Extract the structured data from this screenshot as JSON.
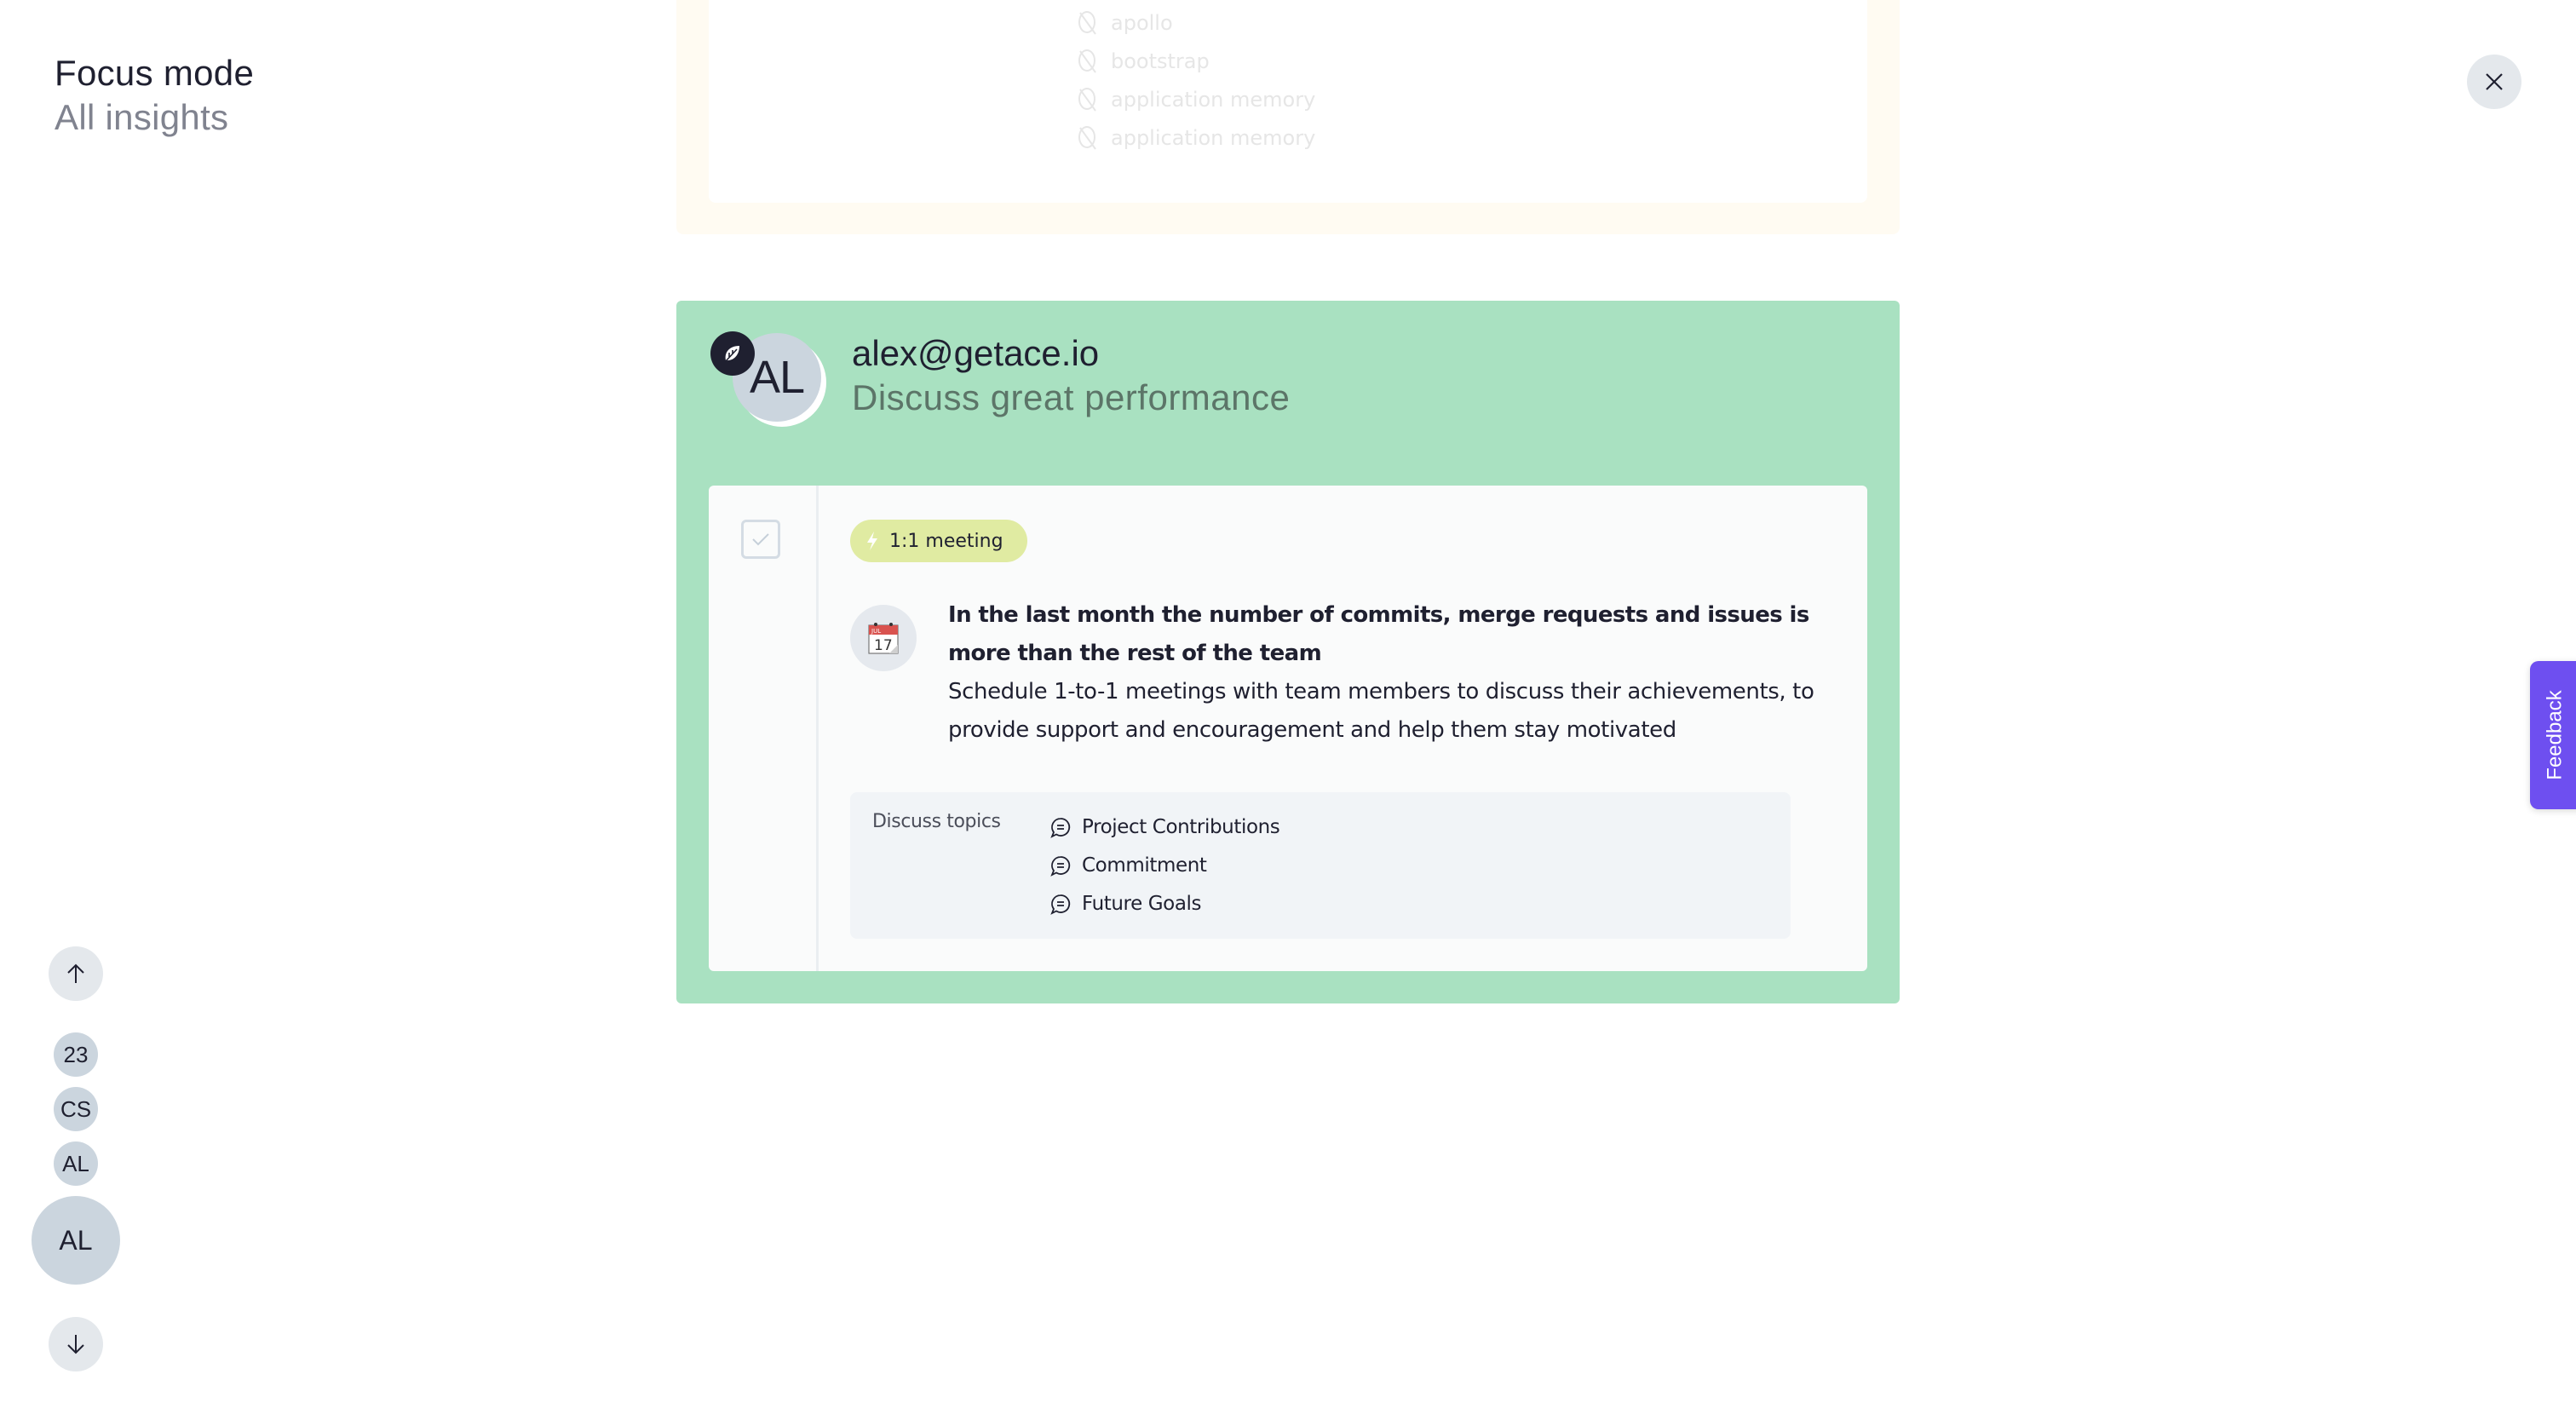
{
  "header": {
    "title": "Focus mode",
    "subtitle": "All insights"
  },
  "close_button": {
    "icon": "close-icon"
  },
  "previous_card": {
    "items": [
      {
        "icon": "leaf-off-icon",
        "label": "apollo"
      },
      {
        "icon": "leaf-off-icon",
        "label": "bootstrap"
      },
      {
        "icon": "leaf-off-icon",
        "label": "application memory"
      },
      {
        "icon": "leaf-off-icon",
        "label": "application memory"
      }
    ],
    "colors": {
      "outer": "#fffbf2"
    }
  },
  "card": {
    "avatar_initials": "AL",
    "badge_icon": "leaf-icon",
    "email": "alex@getace.io",
    "subtitle": "Discuss great performance",
    "colors": {
      "background": "#a9e1c1",
      "panel": "#fafbfb"
    },
    "checkbox": {
      "checked": false
    },
    "tag": {
      "icon": "lightning-icon",
      "label": "1:1 meeting",
      "color": "#e0eba2"
    },
    "insight": {
      "icon": "calendar-icon",
      "calendar_month": "JUL",
      "calendar_day": "17",
      "title": "In the last month the number of commits, merge requests and issues is more than the rest of the team",
      "description": "Schedule 1-to-1 meetings with team members to discuss their achievements, to provide support and encouragement and help them stay motivated"
    },
    "topics": {
      "label": "Discuss topics",
      "items": [
        {
          "icon": "chat-bubble-icon",
          "label": "Project Contributions"
        },
        {
          "icon": "chat-bubble-icon",
          "label": "Commitment"
        },
        {
          "icon": "chat-bubble-icon",
          "label": "Future Goals"
        }
      ]
    }
  },
  "navigator": {
    "up_icon": "arrow-up-icon",
    "down_icon": "arrow-down-icon",
    "items": [
      {
        "label": "23"
      },
      {
        "label": "CS"
      },
      {
        "label": "AL"
      }
    ],
    "active": {
      "label": "AL"
    }
  },
  "feedback": {
    "label": "Feedback",
    "color": "#6e4ff0"
  }
}
